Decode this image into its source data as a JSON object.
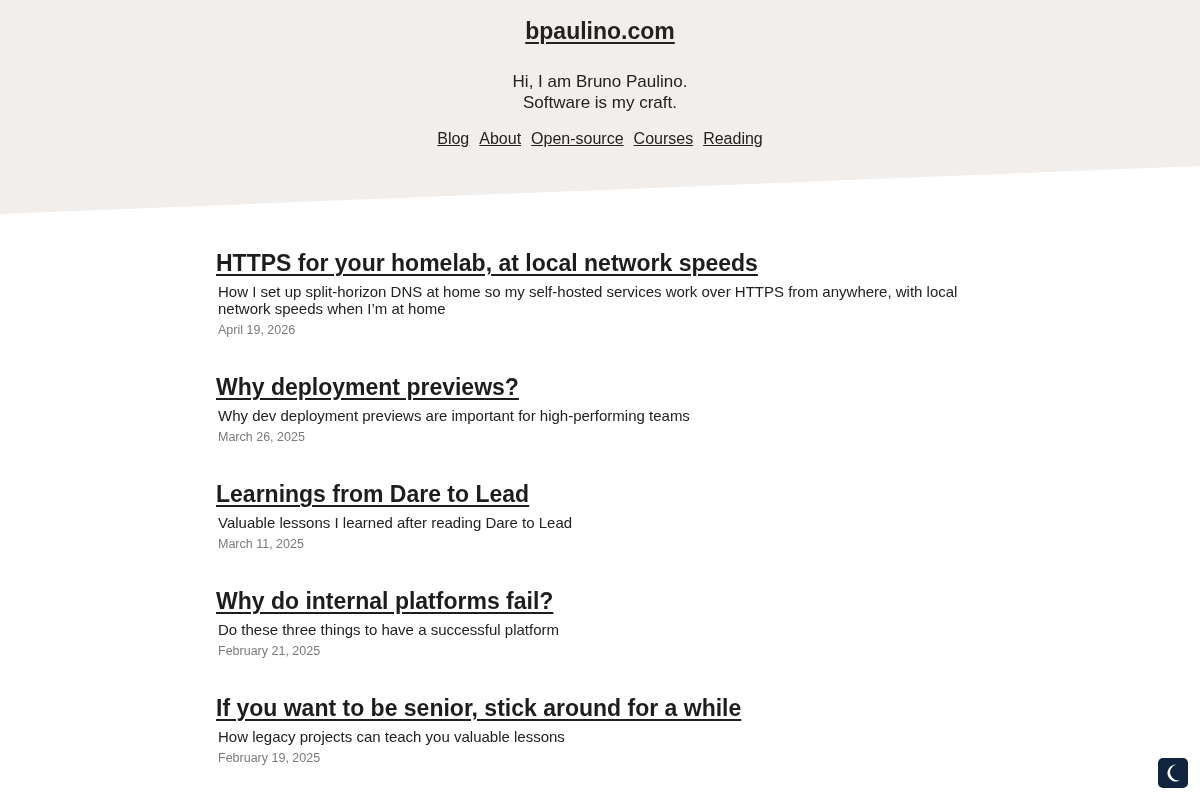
{
  "site": {
    "title": "bpaulino.com",
    "tagline": [
      "Hi, I am Bruno Paulino.",
      "Software is my craft."
    ],
    "nav": [
      "Blog",
      "About",
      "Open-source",
      "Courses",
      "Reading"
    ]
  },
  "posts": [
    {
      "title": "HTTPS for your homelab, at local network speeds",
      "description": "How I set up split-horizon DNS at home so my self-hosted services work over HTTPS from anywhere, with local network speeds when I’m at home",
      "date": "April 19, 2026"
    },
    {
      "title": "Why deployment previews?",
      "description": "Why dev deployment previews are important for high-performing teams",
      "date": "March 26, 2025"
    },
    {
      "title": "Learnings from Dare to Lead",
      "description": "Valuable lessons I learned after reading Dare to Lead",
      "date": "March 11, 2025"
    },
    {
      "title": "Why do internal platforms fail?",
      "description": "Do these three things to have a successful platform",
      "date": "February 21, 2025"
    },
    {
      "title": "If you want to be senior, stick around for a while",
      "description": "How legacy projects can teach you valuable lessons",
      "date": "February 19, 2025"
    }
  ]
}
